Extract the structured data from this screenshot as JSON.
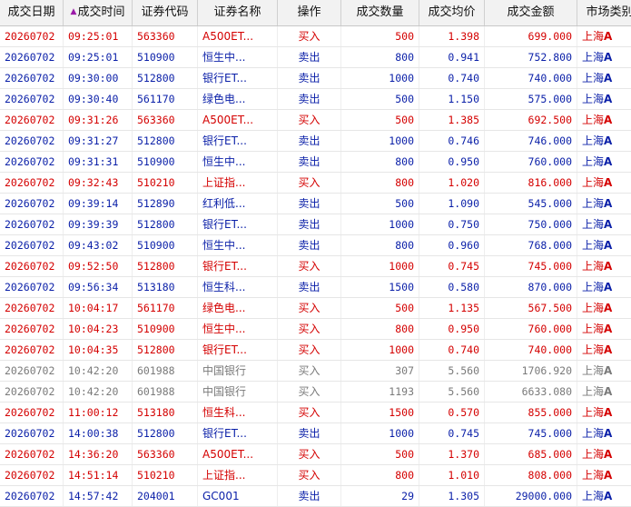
{
  "columns": [
    "成交日期",
    "成交时间",
    "证券代码",
    "证券名称",
    "操作",
    "成交数量",
    "成交均价",
    "成交金额",
    "市场类别",
    ""
  ],
  "sort_indicator": "▲",
  "market_label": "上海",
  "market_suffix": "A",
  "rows": [
    {
      "date": "20260702",
      "time": "09:25:01",
      "code": "563360",
      "name": "A500ET...",
      "op": "买入",
      "qty": "500",
      "price": "1.398",
      "amount": "699.000",
      "market": "上海",
      "mkt": "A",
      "kind": "buy"
    },
    {
      "date": "20260702",
      "time": "09:25:01",
      "code": "510900",
      "name": "恒生中...",
      "op": "卖出",
      "qty": "800",
      "price": "0.941",
      "amount": "752.800",
      "market": "上海",
      "mkt": "A",
      "kind": "sell"
    },
    {
      "date": "20260702",
      "time": "09:30:00",
      "code": "512800",
      "name": "银行ET...",
      "op": "卖出",
      "qty": "1000",
      "price": "0.740",
      "amount": "740.000",
      "market": "上海",
      "mkt": "A",
      "kind": "sell"
    },
    {
      "date": "20260702",
      "time": "09:30:40",
      "code": "561170",
      "name": "绿色电...",
      "op": "卖出",
      "qty": "500",
      "price": "1.150",
      "amount": "575.000",
      "market": "上海",
      "mkt": "A",
      "kind": "sell"
    },
    {
      "date": "20260702",
      "time": "09:31:26",
      "code": "563360",
      "name": "A500ET...",
      "op": "买入",
      "qty": "500",
      "price": "1.385",
      "amount": "692.500",
      "market": "上海",
      "mkt": "A",
      "kind": "buy"
    },
    {
      "date": "20260702",
      "time": "09:31:27",
      "code": "512800",
      "name": "银行ET...",
      "op": "卖出",
      "qty": "1000",
      "price": "0.746",
      "amount": "746.000",
      "market": "上海",
      "mkt": "A",
      "kind": "sell"
    },
    {
      "date": "20260702",
      "time": "09:31:31",
      "code": "510900",
      "name": "恒生中...",
      "op": "卖出",
      "qty": "800",
      "price": "0.950",
      "amount": "760.000",
      "market": "上海",
      "mkt": "A",
      "kind": "sell"
    },
    {
      "date": "20260702",
      "time": "09:32:43",
      "code": "510210",
      "name": "上证指...",
      "op": "买入",
      "qty": "800",
      "price": "1.020",
      "amount": "816.000",
      "market": "上海",
      "mkt": "A",
      "kind": "buy"
    },
    {
      "date": "20260702",
      "time": "09:39:14",
      "code": "512890",
      "name": "红利低...",
      "op": "卖出",
      "qty": "500",
      "price": "1.090",
      "amount": "545.000",
      "market": "上海",
      "mkt": "A",
      "kind": "sell"
    },
    {
      "date": "20260702",
      "time": "09:39:39",
      "code": "512800",
      "name": "银行ET...",
      "op": "卖出",
      "qty": "1000",
      "price": "0.750",
      "amount": "750.000",
      "market": "上海",
      "mkt": "A",
      "kind": "sell"
    },
    {
      "date": "20260702",
      "time": "09:43:02",
      "code": "510900",
      "name": "恒生中...",
      "op": "卖出",
      "qty": "800",
      "price": "0.960",
      "amount": "768.000",
      "market": "上海",
      "mkt": "A",
      "kind": "sell"
    },
    {
      "date": "20260702",
      "time": "09:52:50",
      "code": "512800",
      "name": "银行ET...",
      "op": "买入",
      "qty": "1000",
      "price": "0.745",
      "amount": "745.000",
      "market": "上海",
      "mkt": "A",
      "kind": "buy"
    },
    {
      "date": "20260702",
      "time": "09:56:34",
      "code": "513180",
      "name": "恒生科...",
      "op": "卖出",
      "qty": "1500",
      "price": "0.580",
      "amount": "870.000",
      "market": "上海",
      "mkt": "A",
      "kind": "sell"
    },
    {
      "date": "20260702",
      "time": "10:04:17",
      "code": "561170",
      "name": "绿色电...",
      "op": "买入",
      "qty": "500",
      "price": "1.135",
      "amount": "567.500",
      "market": "上海",
      "mkt": "A",
      "kind": "buy"
    },
    {
      "date": "20260702",
      "time": "10:04:23",
      "code": "510900",
      "name": "恒生中...",
      "op": "买入",
      "qty": "800",
      "price": "0.950",
      "amount": "760.000",
      "market": "上海",
      "mkt": "A",
      "kind": "buy"
    },
    {
      "date": "20260702",
      "time": "10:04:35",
      "code": "512800",
      "name": "银行ET...",
      "op": "买入",
      "qty": "1000",
      "price": "0.740",
      "amount": "740.000",
      "market": "上海",
      "mkt": "A",
      "kind": "buy"
    },
    {
      "date": "20260702",
      "time": "10:42:20",
      "code": "601988",
      "name": "中国银行",
      "op": "买入",
      "qty": "307",
      "price": "5.560",
      "amount": "1706.920",
      "market": "上海",
      "mkt": "A",
      "kind": "gray"
    },
    {
      "date": "20260702",
      "time": "10:42:20",
      "code": "601988",
      "name": "中国银行",
      "op": "买入",
      "qty": "1193",
      "price": "5.560",
      "amount": "6633.080",
      "market": "上海",
      "mkt": "A",
      "kind": "gray"
    },
    {
      "date": "20260702",
      "time": "11:00:12",
      "code": "513180",
      "name": "恒生科...",
      "op": "买入",
      "qty": "1500",
      "price": "0.570",
      "amount": "855.000",
      "market": "上海",
      "mkt": "A",
      "kind": "buy"
    },
    {
      "date": "20260702",
      "time": "14:00:38",
      "code": "512800",
      "name": "银行ET...",
      "op": "卖出",
      "qty": "1000",
      "price": "0.745",
      "amount": "745.000",
      "market": "上海",
      "mkt": "A",
      "kind": "sell"
    },
    {
      "date": "20260702",
      "time": "14:36:20",
      "code": "563360",
      "name": "A500ET...",
      "op": "买入",
      "qty": "500",
      "price": "1.370",
      "amount": "685.000",
      "market": "上海",
      "mkt": "A",
      "kind": "buy"
    },
    {
      "date": "20260702",
      "time": "14:51:14",
      "code": "510210",
      "name": "上证指...",
      "op": "买入",
      "qty": "800",
      "price": "1.010",
      "amount": "808.000",
      "market": "上海",
      "mkt": "A",
      "kind": "buy"
    },
    {
      "date": "20260702",
      "time": "14:57:42",
      "code": "204001",
      "name": "GC001",
      "op": "卖出",
      "qty": "29",
      "price": "1.305",
      "amount": "29000.000",
      "market": "上海",
      "mkt": "A",
      "kind": "sell"
    }
  ]
}
